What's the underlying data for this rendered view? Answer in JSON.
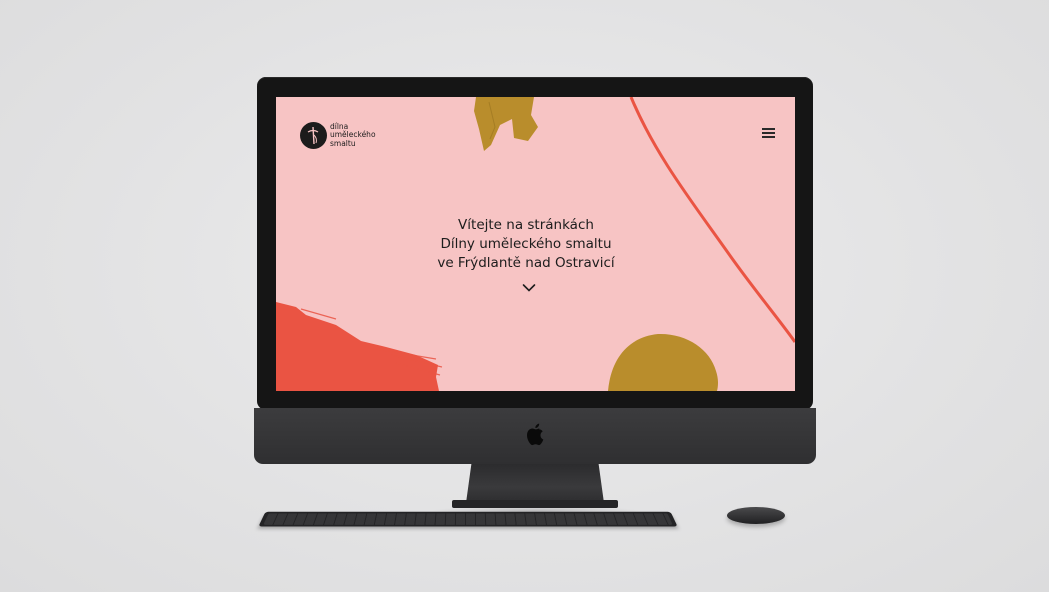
{
  "site": {
    "logo": {
      "line1": "dílna",
      "line2": "uměleckého",
      "line3": "smaltu",
      "icon": "enamel-logo-icon"
    },
    "menu_icon": "hamburger-menu-icon",
    "hero": {
      "line1": "Vítejte na stránkách",
      "line2": "Dílny uměleckého smaltu",
      "line3": "ve Frýdlantě nad Ostravicí"
    },
    "scroll_icon": "chevron-down-icon"
  },
  "colors": {
    "screen_background": "#f7c4c4",
    "accent_red": "#ea5443",
    "accent_ochre": "#b98d2c",
    "text": "#1d1d1d"
  },
  "device": {
    "brand_icon": "apple-logo-icon"
  }
}
